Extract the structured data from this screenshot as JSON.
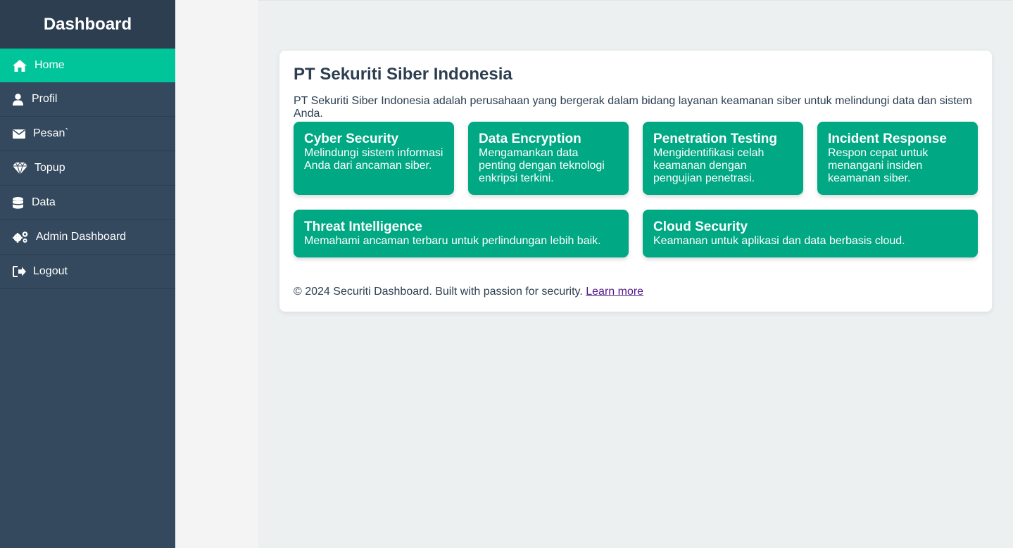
{
  "sidebar": {
    "title": "Dashboard",
    "items": [
      {
        "label": "Home",
        "icon": "home-icon",
        "active": true
      },
      {
        "label": "Profil",
        "icon": "user-icon"
      },
      {
        "label": "Pesan`",
        "icon": "envelope-icon"
      },
      {
        "label": "Topup",
        "icon": "diamond-icon"
      },
      {
        "label": "Data",
        "icon": "database-icon"
      },
      {
        "label": "Admin Dashboard",
        "icon": "gears-icon"
      },
      {
        "label": "Logout",
        "icon": "logout-icon"
      }
    ]
  },
  "main": {
    "title": "PT Sekuriti Siber Indonesia",
    "intro": "PT Sekuriti Siber Indonesia adalah perusahaan yang bergerak dalam bidang layanan keamanan siber untuk melindungi data dan sistem Anda.",
    "services_row1": [
      {
        "title": "Cyber Security",
        "desc": "Melindungi sistem informasi Anda dari ancaman siber."
      },
      {
        "title": "Data Encryption",
        "desc": "Mengamankan data penting dengan teknologi enkripsi terkini."
      },
      {
        "title": "Penetration Testing",
        "desc": "Mengidentifikasi celah keamanan dengan pengujian penetrasi."
      },
      {
        "title": "Incident Response",
        "desc": "Respon cepat untuk menangani insiden keamanan siber."
      }
    ],
    "services_row2": [
      {
        "title": "Threat Intelligence",
        "desc": "Memahami ancaman terbaru untuk perlindungan lebih baik."
      },
      {
        "title": "Cloud Security",
        "desc": "Keamanan untuk aplikasi dan data berbasis cloud."
      }
    ],
    "footer_text": "© 2024 Securiti Dashboard. Built with passion for security.",
    "footer_link": "Learn more"
  },
  "colors": {
    "sidebar_bg": "#34495e",
    "sidebar_header_bg": "#2c3e50",
    "active_item": "#00c49a",
    "service_card": "#00a884",
    "text_dark": "#2c3e50"
  }
}
